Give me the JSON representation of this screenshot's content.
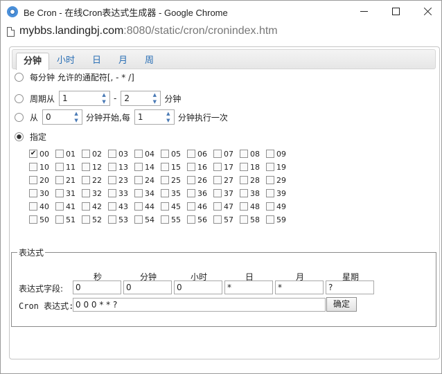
{
  "window": {
    "title": "Be Cron - 在线Cron表达式生成器 - Google Chrome",
    "minimize": "",
    "maximize": "",
    "close": ""
  },
  "address": {
    "host": "mybbs.landingbj.com",
    "rest": ":8080/static/cron/cronindex.htm"
  },
  "tabs": [
    "分钟",
    "小时",
    "日",
    "月",
    "周"
  ],
  "active_tab": "分钟",
  "options": {
    "every": "每分钟 允许的通配符[, - * /]",
    "period_from": "周期从",
    "period_start": "1",
    "period_dash": "-",
    "period_end": "2",
    "period_unit": "分钟",
    "from": "从",
    "from_value": "0",
    "from_mid": "分钟开始,每",
    "every_value": "1",
    "from_unit": "分钟执行一次",
    "specify": "指定",
    "selected": "specify"
  },
  "minutes": [
    {
      "label": "00",
      "checked": true
    },
    {
      "label": "01",
      "checked": false
    },
    {
      "label": "02",
      "checked": false
    },
    {
      "label": "03",
      "checked": false
    },
    {
      "label": "04",
      "checked": false
    },
    {
      "label": "05",
      "checked": false
    },
    {
      "label": "06",
      "checked": false
    },
    {
      "label": "07",
      "checked": false
    },
    {
      "label": "08",
      "checked": false
    },
    {
      "label": "09",
      "checked": false
    },
    {
      "label": "10",
      "checked": false
    },
    {
      "label": "11",
      "checked": false
    },
    {
      "label": "12",
      "checked": false
    },
    {
      "label": "13",
      "checked": false
    },
    {
      "label": "14",
      "checked": false
    },
    {
      "label": "15",
      "checked": false
    },
    {
      "label": "16",
      "checked": false
    },
    {
      "label": "17",
      "checked": false
    },
    {
      "label": "18",
      "checked": false
    },
    {
      "label": "19",
      "checked": false
    },
    {
      "label": "20",
      "checked": false
    },
    {
      "label": "21",
      "checked": false
    },
    {
      "label": "22",
      "checked": false
    },
    {
      "label": "23",
      "checked": false
    },
    {
      "label": "24",
      "checked": false
    },
    {
      "label": "25",
      "checked": false
    },
    {
      "label": "26",
      "checked": false
    },
    {
      "label": "27",
      "checked": false
    },
    {
      "label": "28",
      "checked": false
    },
    {
      "label": "29",
      "checked": false
    },
    {
      "label": "30",
      "checked": false
    },
    {
      "label": "31",
      "checked": false
    },
    {
      "label": "32",
      "checked": false
    },
    {
      "label": "33",
      "checked": false
    },
    {
      "label": "34",
      "checked": false
    },
    {
      "label": "35",
      "checked": false
    },
    {
      "label": "36",
      "checked": false
    },
    {
      "label": "37",
      "checked": false
    },
    {
      "label": "38",
      "checked": false
    },
    {
      "label": "39",
      "checked": false
    },
    {
      "label": "40",
      "checked": false
    },
    {
      "label": "41",
      "checked": false
    },
    {
      "label": "42",
      "checked": false
    },
    {
      "label": "43",
      "checked": false
    },
    {
      "label": "44",
      "checked": false
    },
    {
      "label": "45",
      "checked": false
    },
    {
      "label": "46",
      "checked": false
    },
    {
      "label": "47",
      "checked": false
    },
    {
      "label": "48",
      "checked": false
    },
    {
      "label": "49",
      "checked": false
    },
    {
      "label": "50",
      "checked": false
    },
    {
      "label": "51",
      "checked": false
    },
    {
      "label": "52",
      "checked": false
    },
    {
      "label": "53",
      "checked": false
    },
    {
      "label": "54",
      "checked": false
    },
    {
      "label": "55",
      "checked": false
    },
    {
      "label": "56",
      "checked": false
    },
    {
      "label": "57",
      "checked": false
    },
    {
      "label": "58",
      "checked": false
    },
    {
      "label": "59",
      "checked": false
    }
  ],
  "expression": {
    "legend": "表达式",
    "headers": [
      "秒",
      "分钟",
      "小时",
      "日",
      "月",
      "星期"
    ],
    "fields_label": "表达式字段:",
    "fields": [
      "0",
      "0",
      "0",
      "*",
      "*",
      "?"
    ],
    "cron_label": "Cron 表达式:",
    "cron_value": "0 0 0 * * ?",
    "ok_button": "确定"
  },
  "icons": {
    "app": "chrome-icon",
    "page": "page-icon",
    "radio": "radio-button",
    "spinner": "spinner-arrows"
  }
}
